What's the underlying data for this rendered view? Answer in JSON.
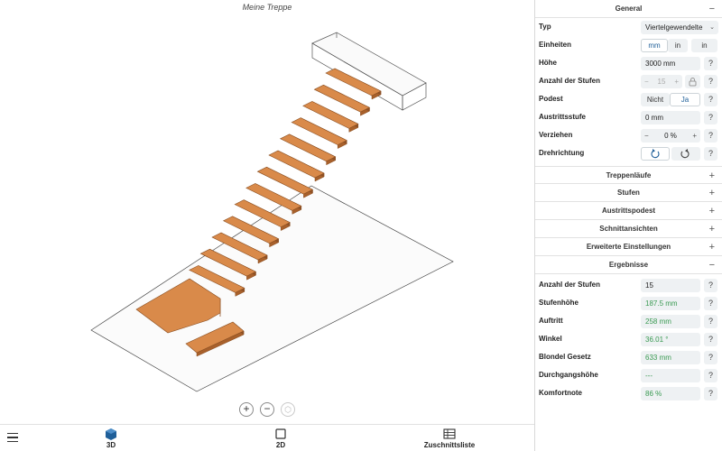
{
  "viewport": {
    "title": "Meine Treppe",
    "zoom_in": "+",
    "zoom_out": "−",
    "reset_view": "⬡"
  },
  "tabs": [
    {
      "label": "3D",
      "icon": "cube-icon"
    },
    {
      "label": "2D",
      "icon": "square-icon"
    },
    {
      "label": "Zuschnittsliste",
      "icon": "table-icon"
    }
  ],
  "general": {
    "header": "General",
    "toggle": "−",
    "typ_label": "Typ",
    "typ_value": "Viertelgewendelte",
    "einheiten_label": "Einheiten",
    "units": [
      "mm",
      "in",
      "in"
    ],
    "hoehe_label": "Höhe",
    "hoehe_value": "3000 mm",
    "stufen_label": "Anzahl der Stufen",
    "stufen_minus": "−",
    "stufen_value": "15",
    "stufen_plus": "+",
    "podest_label": "Podest",
    "podest_options": [
      "Nicht",
      "Ja"
    ],
    "austritt_label": "Austrittsstufe",
    "austritt_value": "0 mm",
    "verziehen_label": "Verziehen",
    "verziehen_minus": "−",
    "verziehen_value": "0 %",
    "verziehen_plus": "+",
    "dreh_label": "Drehrichtung",
    "help": "?"
  },
  "collapsed_sections": [
    {
      "label": "Treppenläufe",
      "toggle": "+"
    },
    {
      "label": "Stufen",
      "toggle": "+"
    },
    {
      "label": "Austrittspodest",
      "toggle": "+"
    },
    {
      "label": "Schnittansichten",
      "toggle": "+"
    },
    {
      "label": "Erweiterte Einstellungen",
      "toggle": "+"
    }
  ],
  "results": {
    "header": "Ergebnisse",
    "toggle": "−",
    "rows": [
      {
        "label": "Anzahl der Stufen",
        "value": "15",
        "kind": "plain"
      },
      {
        "label": "Stufenhöhe",
        "value": "187.5 mm",
        "kind": "res"
      },
      {
        "label": "Auftritt",
        "value": "258 mm",
        "kind": "res"
      },
      {
        "label": "Winkel",
        "value": "36.01 °",
        "kind": "res"
      },
      {
        "label": "Blondel Gesetz",
        "value": "633 mm",
        "kind": "res"
      },
      {
        "label": "Durchgangshöhe",
        "value": "---",
        "kind": "res"
      },
      {
        "label": "Komfortnote",
        "value": "86 %",
        "kind": "res"
      }
    ]
  },
  "colors": {
    "accent": "#1f5f99",
    "result_green": "#3a9a52",
    "tread": "#d98a4a",
    "tread_edge": "#8a4f22",
    "control_bg": "#eef1f3"
  }
}
